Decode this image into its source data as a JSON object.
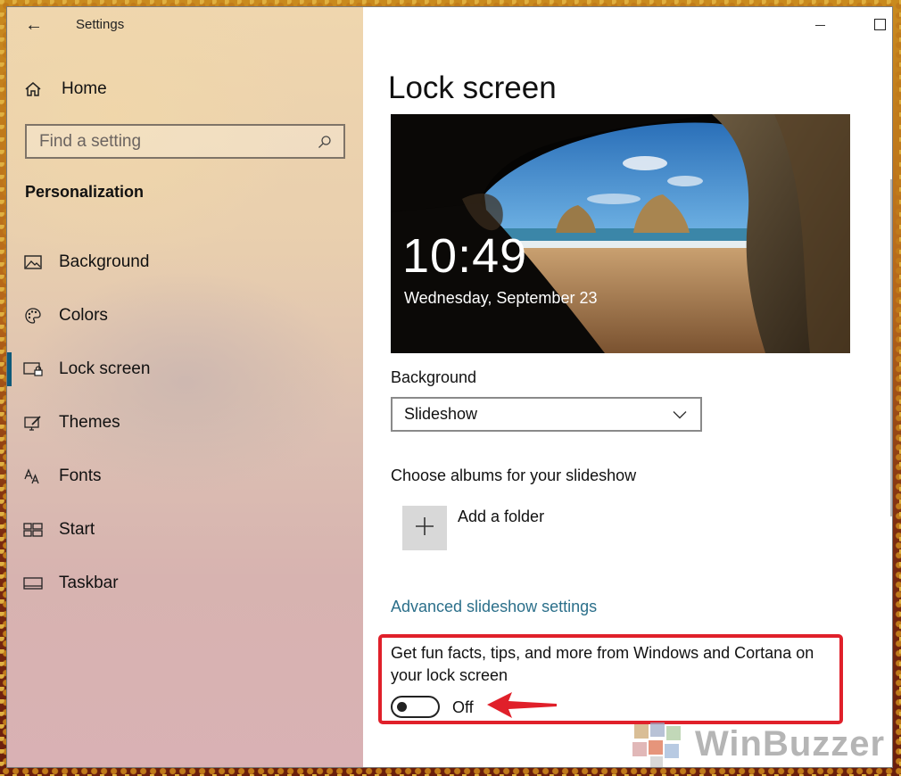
{
  "window": {
    "title": "Settings"
  },
  "sidebar": {
    "home_label": "Home",
    "search_placeholder": "Find a setting",
    "section_title": "Personalization",
    "items": [
      {
        "label": "Background",
        "icon": "image-icon"
      },
      {
        "label": "Colors",
        "icon": "palette-icon"
      },
      {
        "label": "Lock screen",
        "icon": "lock-screen-icon",
        "selected": true
      },
      {
        "label": "Themes",
        "icon": "themes-icon"
      },
      {
        "label": "Fonts",
        "icon": "fonts-icon"
      },
      {
        "label": "Start",
        "icon": "start-icon"
      },
      {
        "label": "Taskbar",
        "icon": "taskbar-icon"
      }
    ]
  },
  "main": {
    "page_title": "Lock screen",
    "preview": {
      "time": "10:49",
      "date": "Wednesday, September 23"
    },
    "background_label": "Background",
    "background_value": "Slideshow",
    "albums_label": "Choose albums for your slideshow",
    "add_folder_label": "Add a folder",
    "advanced_link": "Advanced slideshow settings",
    "tips_text": "Get fun facts, tips, and more from Windows and Cortana on your lock screen",
    "tips_toggle_label": "Off",
    "tips_toggle_on": false
  },
  "watermark": {
    "text": "WinBuzzer"
  },
  "colors": {
    "accent": "#0f5a7a",
    "link": "#2b6f8a",
    "highlight": "#e0202a"
  }
}
